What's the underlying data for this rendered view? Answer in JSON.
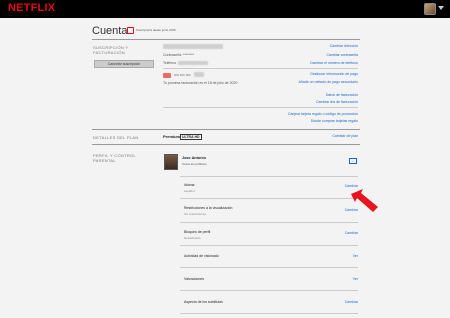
{
  "header": {
    "logo": "NETFLIX"
  },
  "account": {
    "title": "Cuenta",
    "member_since": "Suscriptor/a desde junio 2015"
  },
  "membership": {
    "section_label": "SUSCRIPCIÓN Y FACTURACIÓN",
    "cancel_button": "Cancelar suscripción",
    "password_label": "Contraseña: ********",
    "phone_label": "Teléfono",
    "card_mask": "•••• •••• ••••",
    "next_billing": "Tu próxima facturación es el 18 de julio de 2020",
    "links": {
      "change_email": "Cambiar dirección",
      "change_password": "Cambiar contraseña",
      "change_phone": "Cambiar el número de teléfono",
      "manage_payment": "Gestionar información de pago",
      "add_backup_payment": "Añadir un método de pago secundario",
      "billing_details": "Datos de facturación",
      "change_billing_day": "Cambiar día de facturación",
      "redeem_gift": "Canjear tarjeta regalo o código de promoción",
      "buy_gift": "Dónde comprar tarjetas regalo"
    }
  },
  "plan": {
    "section_label": "DETALLES DEL PLAN",
    "name": "Premium",
    "badge": "ULTRA HD",
    "change_plan": "Cambiar de plan"
  },
  "profile": {
    "section_label": "PERFIL Y CONTROL PARENTAL",
    "name": "Jose Antonio",
    "subtitle": "Todos los públicos",
    "rows": [
      {
        "title": "Idioma",
        "value": "español",
        "action": "Cambiar"
      },
      {
        "title": "Restricciones a la visualización",
        "value": "Sin restricciones",
        "action": "Cambiar"
      },
      {
        "title": "Bloqueo de perfil",
        "value": "Desactivado",
        "action": "Cambiar"
      },
      {
        "title": "Actividad de visionado",
        "value": "",
        "action": "Ver"
      },
      {
        "title": "Valoraciones",
        "value": "",
        "action": "Ver"
      },
      {
        "title": "Aspecto de los subtítulos",
        "value": "",
        "action": "Cambiar"
      }
    ]
  },
  "colors": {
    "brand": "#e50914",
    "link": "#1a66c8",
    "arrow": "#e8141e"
  }
}
